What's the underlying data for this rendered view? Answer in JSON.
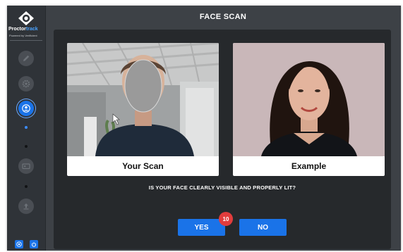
{
  "brand": {
    "name_main": "Proctor",
    "name_accent": "track",
    "tagline": "Powered by Verificient"
  },
  "header": {
    "title": "FACE SCAN"
  },
  "scan": {
    "your_label": "Your Scan",
    "example_label": "Example"
  },
  "question": "IS YOUR FACE CLEARLY VISIBLE AND PROPERLY LIT?",
  "actions": {
    "yes_label": "YES",
    "no_label": "NO",
    "countdown": "10"
  },
  "sidebar": {
    "items": [
      {
        "icon": "pencil-icon",
        "state": "disabled"
      },
      {
        "icon": "gear-icon",
        "state": "disabled"
      },
      {
        "icon": "user-icon",
        "state": "active"
      },
      {
        "icon": "id-card-icon",
        "state": "disabled"
      },
      {
        "icon": "upload-icon",
        "state": "disabled"
      }
    ],
    "bottom": [
      "help-icon",
      "power-icon"
    ]
  },
  "colors": {
    "accent": "#1a73e8",
    "badge": "#e23c3c",
    "panel": "#26292c",
    "window": "#3d4146"
  }
}
